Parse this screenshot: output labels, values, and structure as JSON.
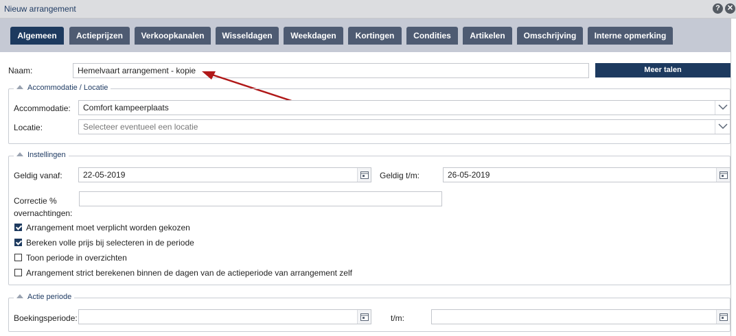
{
  "window": {
    "title": "Nieuw arrangement",
    "help_icon": "question-circle-icon",
    "close_icon": "close-circle-icon"
  },
  "tabs": [
    {
      "label": "Algemeen",
      "active": true
    },
    {
      "label": "Actieprijzen"
    },
    {
      "label": "Verkoopkanalen"
    },
    {
      "label": "Wisseldagen"
    },
    {
      "label": "Weekdagen"
    },
    {
      "label": "Kortingen"
    },
    {
      "label": "Condities"
    },
    {
      "label": "Artikelen"
    },
    {
      "label": "Omschrijving"
    },
    {
      "label": "Interne opmerking"
    }
  ],
  "naam": {
    "label": "Naam:",
    "value": "Hemelvaart arrangement - kopie"
  },
  "meer_talen_label": "Meer talen",
  "accommodatie_section": {
    "legend": "Accommodatie / Locatie",
    "accommodatie_label": "Accommodatie:",
    "accommodatie_value": "Comfort kampeerplaats",
    "locatie_label": "Locatie:",
    "locatie_placeholder": "Selecteer eventueel een locatie"
  },
  "instellingen": {
    "legend": "Instellingen",
    "geldig_vanaf_label": "Geldig vanaf:",
    "geldig_vanaf_value": "22-05-2019",
    "geldig_tm_label": "Geldig t/m:",
    "geldig_tm_value": "26-05-2019",
    "correctie_label_1": "Correctie %",
    "correctie_label_2": "overnachtingen:",
    "correctie_value": "",
    "checkboxes": [
      {
        "label": "Arrangement moet verplicht worden gekozen",
        "checked": true
      },
      {
        "label": "Bereken volle prijs bij selecteren in de periode",
        "checked": true
      },
      {
        "label": "Toon periode in overzichten",
        "checked": false
      },
      {
        "label": "Arrangement strict berekenen binnen de dagen van de actieperiode van arrangement zelf",
        "checked": false
      }
    ]
  },
  "actie_periode": {
    "legend": "Actie periode",
    "boekingsperiode_label": "Boekingsperiode:",
    "boekingsperiode_value": "",
    "tm_label": "t/m:",
    "tm_value": ""
  },
  "colors": {
    "accent": "#1d3a5f",
    "tab": "#4e5b72",
    "tabbar": "#c5c9d4",
    "arrow": "#b01818"
  }
}
